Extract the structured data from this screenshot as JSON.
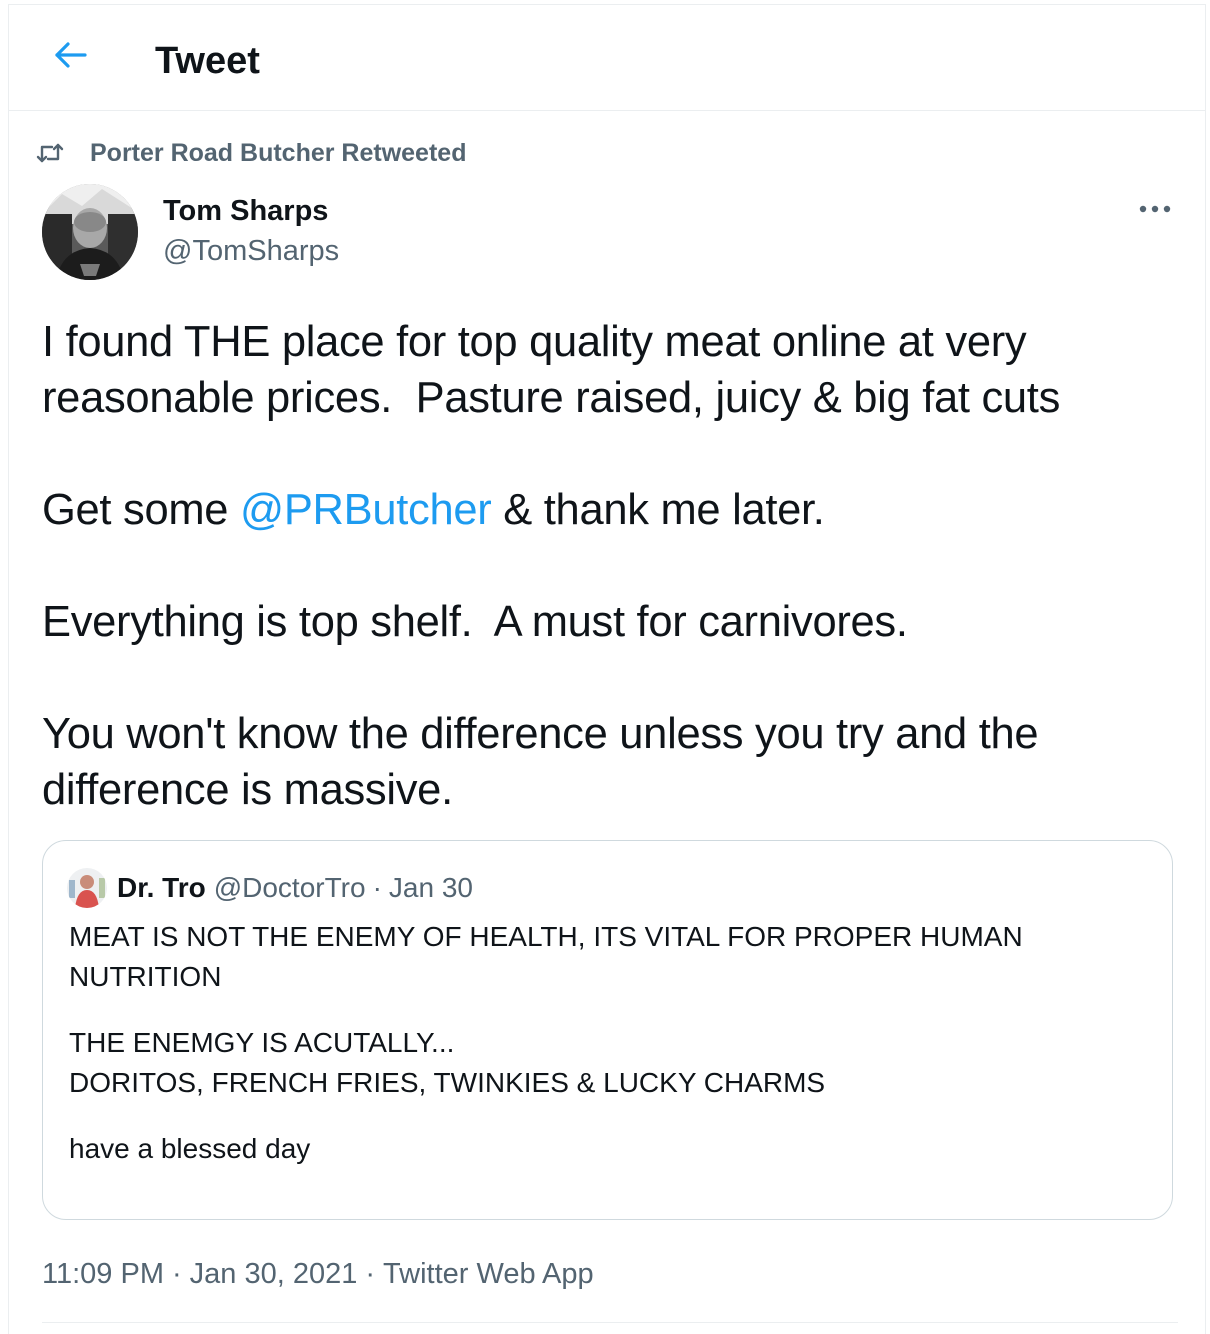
{
  "header": {
    "title": "Tweet"
  },
  "retweet": {
    "label": "Porter Road Butcher Retweeted"
  },
  "author": {
    "name": "Tom Sharps",
    "handle": "@TomSharps"
  },
  "tweet": {
    "line1": "I found THE place for top quality meat online at very",
    "line2": "reasonable prices.  Pasture raised, juicy & big fat cuts",
    "line3_pre": "Get some ",
    "line3_mention": "@PRButcher",
    "line3_post": " & thank me later.",
    "line4": "Everything is top shelf.  A must for carnivores.",
    "line5": "You won't know the difference unless you try and the",
    "line6": "difference is massive."
  },
  "quote": {
    "name": "Dr. Tro",
    "handle": "@DoctorTro",
    "separator": "·",
    "date": "Jan 30",
    "line1": "MEAT IS NOT THE ENEMY OF HEALTH, ITS VITAL FOR PROPER HUMAN",
    "line2": "NUTRITION",
    "line3": "THE ENEMGY IS ACUTALLY...",
    "line4": "DORITOS, FRENCH FRIES, TWINKIES & LUCKY CHARMS",
    "line5": "have a blessed day"
  },
  "meta": {
    "time": "11:09 PM",
    "separator": "·",
    "date": "Jan 30, 2021",
    "source": "Twitter Web App"
  },
  "colors": {
    "accent": "#1d9bf0",
    "text": "#0f1419",
    "secondary": "#536471",
    "border": "#cfd9de"
  }
}
